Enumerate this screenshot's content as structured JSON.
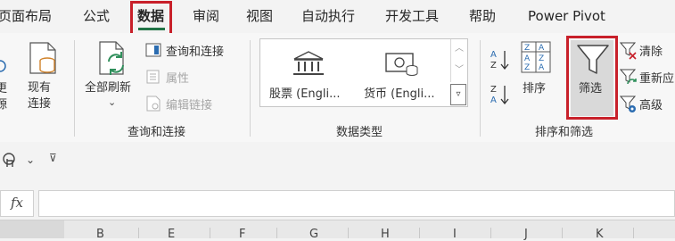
{
  "tabs": [
    "页面布局",
    "公式",
    "数据",
    "审阅",
    "视图",
    "自动执行",
    "开发工具",
    "帮助",
    "Power Pivot"
  ],
  "active_tab": "数据",
  "ribbon": {
    "cut_left_labels": [
      "更",
      "源"
    ],
    "existing_connections": [
      "现有",
      "连接"
    ],
    "refresh_all": "全部刷新",
    "queries_connections": "查询和连接",
    "properties": "属性",
    "edit_links": "编辑链接",
    "group_queries": "查询和连接",
    "stocks": "股票 (Engli...",
    "currencies": "货币 (Engli...",
    "group_data_types": "数据类型",
    "sort": "排序",
    "filter": "筛选",
    "clear": "清除",
    "reapply": "重新应",
    "advanced": "高级",
    "group_sort_filter": "排序和筛选"
  },
  "formula_bar": {
    "fx": "fx",
    "value": ""
  },
  "columns": [
    "B",
    "E",
    "F",
    "G",
    "H",
    "I",
    "J",
    "K"
  ],
  "colors": {
    "accent_green": "#217346",
    "highlight_red": "#c8202a",
    "icon_teal": "#2f8f5b",
    "icon_blue": "#2b6cb0"
  }
}
